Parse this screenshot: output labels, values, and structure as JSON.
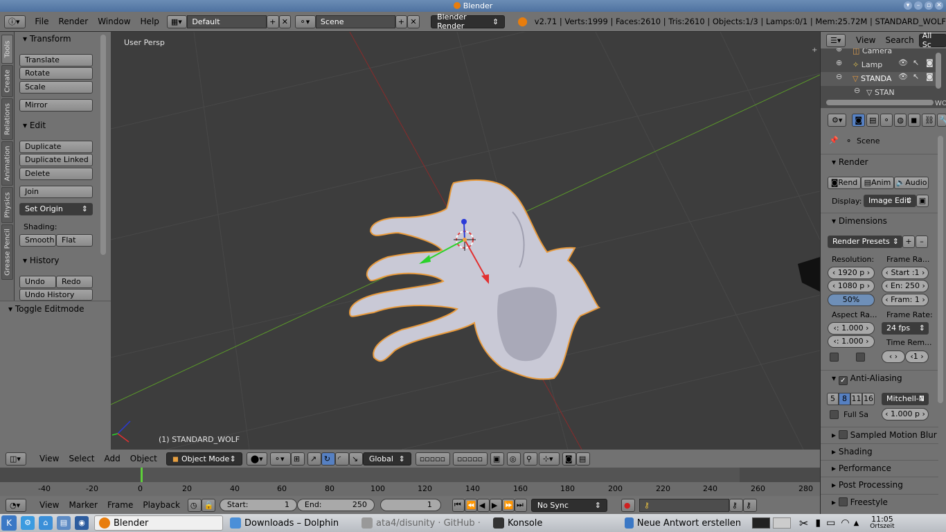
{
  "window": {
    "title": "Blender"
  },
  "info_header": {
    "menus": [
      "File",
      "Render",
      "Window",
      "Help"
    ],
    "layout": "Default",
    "scene": "Scene",
    "engine": "Blender Render",
    "stats": "v2.71 | Verts:1999 | Faces:2610 | Tris:2610 | Objects:1/3 | Lamps:0/1 | Mem:25.72M | STANDARD_WOLF"
  },
  "tool_tabs": [
    "Tools",
    "Create",
    "Relations",
    "Animation",
    "Physics",
    "Grease Pencil"
  ],
  "tool_shelf": {
    "transform_title": "Transform",
    "translate": "Translate",
    "rotate": "Rotate",
    "scale": "Scale",
    "mirror": "Mirror",
    "edit_title": "Edit",
    "duplicate": "Duplicate",
    "duplicate_linked": "Duplicate Linked",
    "delete": "Delete",
    "join": "Join",
    "set_origin": "Set Origin",
    "shading_label": "Shading:",
    "smooth": "Smooth",
    "flat": "Flat",
    "history_title": "History",
    "undo": "Undo",
    "redo": "Redo",
    "undo_history": "Undo History",
    "toggle_editmode": "Toggle Editmode"
  },
  "viewport": {
    "view_label": "User Persp",
    "object_label": "(1) STANDARD_WOLF"
  },
  "view3d_header": {
    "menus": [
      "View",
      "Select",
      "Add",
      "Object"
    ],
    "mode": "Object Mode",
    "orientation": "Global"
  },
  "timeline": {
    "ticks": [
      "-40",
      "-20",
      "0",
      "20",
      "40",
      "60",
      "80",
      "100",
      "120",
      "140",
      "160",
      "180",
      "200",
      "220",
      "240",
      "260",
      "280"
    ],
    "menus": [
      "View",
      "Marker",
      "Frame",
      "Playback"
    ],
    "start": "Start:",
    "start_value": "1",
    "end": "End:",
    "end_value": "250",
    "current": "1",
    "sync": "No Sync"
  },
  "outliner": {
    "menus": [
      "View",
      "Search"
    ],
    "filter": "All Sc",
    "items": [
      "Camera",
      "Lamp",
      "STANDA",
      "STAN"
    ],
    "overflow_text": "WO"
  },
  "properties": {
    "breadcrumb": "Scene",
    "render_title": "Render",
    "render_btn": "Rend",
    "anim_btn": "Anim",
    "audio_btn": "Audio",
    "display_label": "Display:",
    "display_value": "Image Edit",
    "dimensions_title": "Dimensions",
    "render_presets": "Render Presets",
    "resolution_label": "Resolution:",
    "res_x": "1920 p",
    "res_y": "1080 p",
    "res_pct": "50%",
    "frame_range_label": "Frame Ra...",
    "frame_start": "Start :1",
    "frame_end": "En: 250",
    "frame_step": "Fram: 1",
    "aspect_label": "Aspect Ra...",
    "aspect_x": "1.000",
    "aspect_y": "1.000",
    "frame_rate_label": "Frame Rate:",
    "frame_rate": "24 fps",
    "time_remap_label": "Time Rem...",
    "time_remap_new": "1",
    "aa_title": "Anti-Aliasing",
    "aa_samples": [
      "5",
      "8",
      "11",
      "16"
    ],
    "aa_filter": "Mitchell-N",
    "full_sample": "Full Sa",
    "filter_size": "1.000 p",
    "sampled_motion_blur": "Sampled Motion Blur",
    "shading": "Shading",
    "performance": "Performance",
    "post_processing": "Post Processing",
    "freestyle": "Freestyle"
  },
  "taskbar": {
    "tasks": [
      "Blender",
      "Downloads – Dolphin",
      "ata4/disunity · GitHub ·",
      "Konsole",
      "Neue Antwort erstellen"
    ],
    "time": "11:05",
    "time_label": "Ortszeit"
  }
}
